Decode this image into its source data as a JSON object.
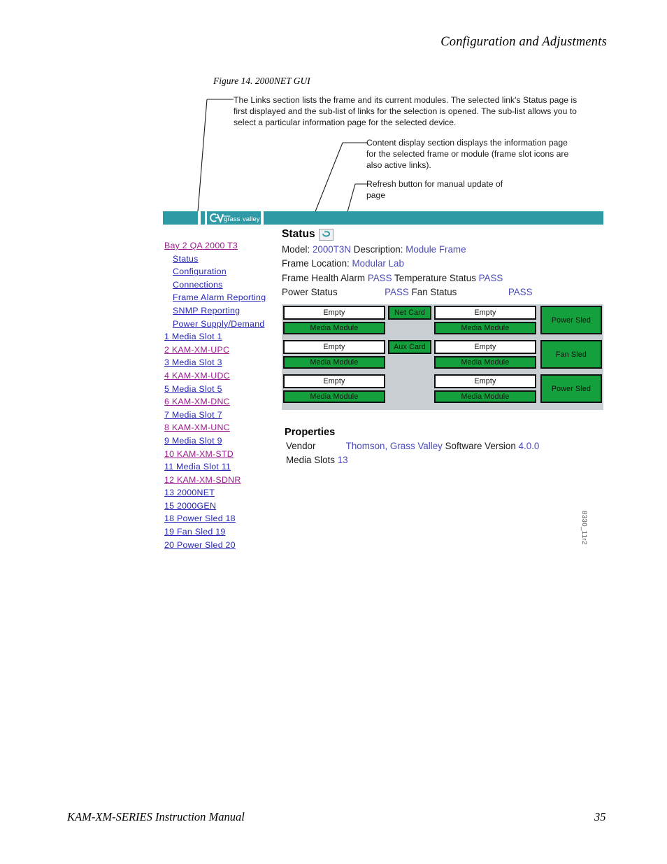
{
  "page": {
    "running_head": "Configuration and Adjustments",
    "footer_left": "KAM-XM-SERIES Instruction Manual",
    "footer_right": "35",
    "figure_caption": "Figure 14.  2000NET GUI",
    "figure_id": "8330_11r2"
  },
  "callouts": {
    "links": "The Links section lists the frame and its current modules. The selected link's Status page is first displayed and the sub-list of links for the selection is opened. The sub-list allows you to select a particular information page for the selected device.",
    "content": "Content display section displays the information page for the selected frame or module (frame slot icons are also active links).",
    "refresh": "Refresh button for manual update of page"
  },
  "gui": {
    "logo": {
      "mark": "GV",
      "wordmark_1": "grass",
      "wordmark_2": "valley"
    },
    "header_color": "#2e9aa6",
    "links": [
      {
        "label": "Bay 2 QA 2000 T3",
        "style": "root"
      },
      {
        "label": "Status",
        "style": "sub"
      },
      {
        "label": "Configuration",
        "style": "sub"
      },
      {
        "label": "Connections",
        "style": "sub"
      },
      {
        "label": "Frame Alarm Reporting",
        "style": "sub"
      },
      {
        "label": "SNMP Reporting",
        "style": "sub"
      },
      {
        "label": "Power Supply/Demand",
        "style": "sub"
      },
      {
        "label": "1 Media Slot 1",
        "style": "blue"
      },
      {
        "label": "2 KAM-XM-UPC",
        "style": "purple"
      },
      {
        "label": "3 Media Slot 3",
        "style": "blue"
      },
      {
        "label": "4 KAM-XM-UDC",
        "style": "purple"
      },
      {
        "label": "5 Media Slot 5",
        "style": "blue"
      },
      {
        "label": "6 KAM-XM-DNC",
        "style": "purple"
      },
      {
        "label": "7 Media Slot 7",
        "style": "blue"
      },
      {
        "label": "8 KAM-XM-UNC",
        "style": "purple"
      },
      {
        "label": "9 Media Slot 9",
        "style": "blue"
      },
      {
        "label": "10 KAM-XM-STD",
        "style": "purple"
      },
      {
        "label": "11 Media Slot 11",
        "style": "blue"
      },
      {
        "label": "12 KAM-XM-SDNR",
        "style": "purple"
      },
      {
        "label": "13 2000NET",
        "style": "blue"
      },
      {
        "label": "15 2000GEN",
        "style": "blue"
      },
      {
        "label": "18 Power Sled 18",
        "style": "blue"
      },
      {
        "label": "19 Fan Sled 19",
        "style": "blue"
      },
      {
        "label": "20 Power Sled 20",
        "style": "blue"
      }
    ],
    "status": {
      "title": "Status",
      "refresh_icon": "refresh-icon",
      "model_label": "Model:",
      "model_value": "2000T3N",
      "description_label": "Description:",
      "description_value": "Module Frame",
      "frame_location_label": "Frame Location:",
      "frame_location_value": "Modular Lab",
      "frame_health_label": "Frame Health Alarm",
      "frame_health_value": "PASS",
      "temperature_label": "Temperature Status",
      "temperature_value": "PASS",
      "power_label": "Power Status",
      "power_value": "PASS",
      "fan_label": "Fan Status",
      "fan_value": "PASS"
    },
    "frame_slots": {
      "rows": [
        {
          "left_top": "Empty",
          "left_bottom": "Media Module",
          "center": "Net Card",
          "right_top": "Empty",
          "right_bottom": "Media Module",
          "sled": "Power Sled"
        },
        {
          "left_top": "Empty",
          "left_bottom": "Media Module",
          "center": "Aux Card",
          "right_top": "Empty",
          "right_bottom": "Media Module",
          "sled": "Fan Sled"
        },
        {
          "left_top": "Empty",
          "left_bottom": "Media Module",
          "center": "",
          "right_top": "Empty",
          "right_bottom": "Media Module",
          "sled": "Power Sled"
        }
      ]
    },
    "properties": {
      "title": "Properties",
      "vendor_label": "Vendor",
      "vendor_value": "Thomson, Grass Valley",
      "software_label": "Software Version",
      "software_value": "4.0.0",
      "media_slots_label": "Media Slots",
      "media_slots_value": "13"
    }
  }
}
